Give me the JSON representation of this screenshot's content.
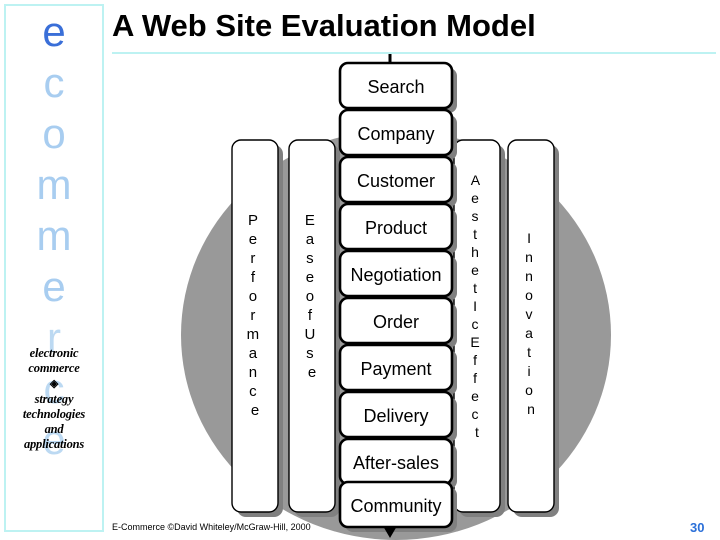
{
  "slide": {
    "title": "A Web Site Evaluation Model",
    "page_number": "30",
    "footer_credit": "E-Commerce ©David Whiteley/McGraw-Hill, 2000",
    "background_color": "#ffffff",
    "accent_color": "#bdf2f2"
  },
  "sidebar": {
    "brand_letters": [
      "e",
      "c",
      "o",
      "m",
      "m",
      "e",
      "r",
      "c",
      "e"
    ],
    "brand_colors": [
      "#3a6fd8",
      "#a8cdf0",
      "#a8cdf0",
      "#a8cdf0",
      "#a8cdf0",
      "#a8cdf0",
      "#bcd9f2",
      "#bcd9f2",
      "#bcd9f2"
    ],
    "tagline": {
      "line1": "electronic",
      "line2": "commerce",
      "diamond": "◈",
      "line3": "strategy",
      "line4": "technologies",
      "line5": "and",
      "line6": "applications"
    },
    "border_color": "#bdf2f2"
  },
  "diagram": {
    "background_circle_color": "#999999",
    "box_fill": "#ffffff",
    "box_stroke": "#000000",
    "shadow_color": "#808080",
    "process_boxes": [
      "Search",
      "Company",
      "Customer",
      "Product",
      "Negotiation",
      "Order",
      "Payment",
      "Delivery",
      "After-sales",
      "Community"
    ],
    "columns": [
      {
        "id": "performance",
        "label": "Performance",
        "letters": [
          "P",
          "e",
          "r",
          "f",
          "o",
          "r",
          "m",
          "a",
          "n",
          "c",
          "e"
        ]
      },
      {
        "id": "ease-of-use",
        "label": "Ease of Use",
        "letters": [
          "E",
          "a",
          "s",
          "e",
          " ",
          "o",
          "f",
          " ",
          "U",
          "s",
          "e"
        ]
      },
      {
        "id": "aesthetic-effect",
        "label": "Aesthetic Effect",
        "letters": [
          "A",
          "e",
          "s",
          "t",
          "h",
          "e",
          "t",
          "I",
          "c",
          " ",
          "E",
          "f",
          "f",
          "e",
          "c",
          "t"
        ]
      },
      {
        "id": "innovation",
        "label": "Innovation",
        "letters": [
          "I",
          "n",
          "n",
          "o",
          "v",
          "a",
          "t",
          "i",
          "o",
          "n"
        ]
      }
    ],
    "flow_arrows": 11
  }
}
